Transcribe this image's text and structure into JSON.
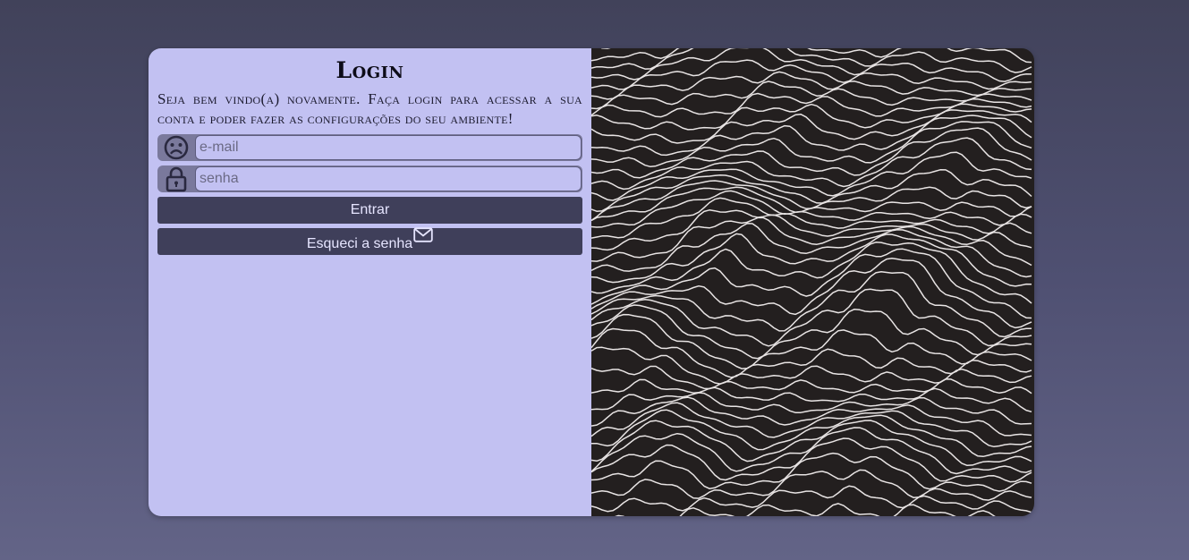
{
  "login": {
    "title": "Login",
    "description": "Seja bem vindo(a) novamente. Faça login para acessar a sua conta e poder fazer as configurações do seu ambiente!",
    "email": {
      "placeholder": "e-mail",
      "value": "",
      "icon": "sad-face-icon"
    },
    "password": {
      "placeholder": "senha",
      "value": "",
      "icon": "lock-icon"
    },
    "submit_label": "Entrar",
    "forgot_label": "Esqueci a senha",
    "forgot_icon": "mail-icon"
  },
  "colors": {
    "background_top": "#41425a",
    "background_bottom": "#636487",
    "panel": "#c2c1f2",
    "button": "#3f3f5a",
    "art_background": "#231f1f",
    "art_lines": "#e8e4e4"
  },
  "art": {
    "type": "decorative-wave-lines",
    "icon": "wave-lines-art"
  }
}
